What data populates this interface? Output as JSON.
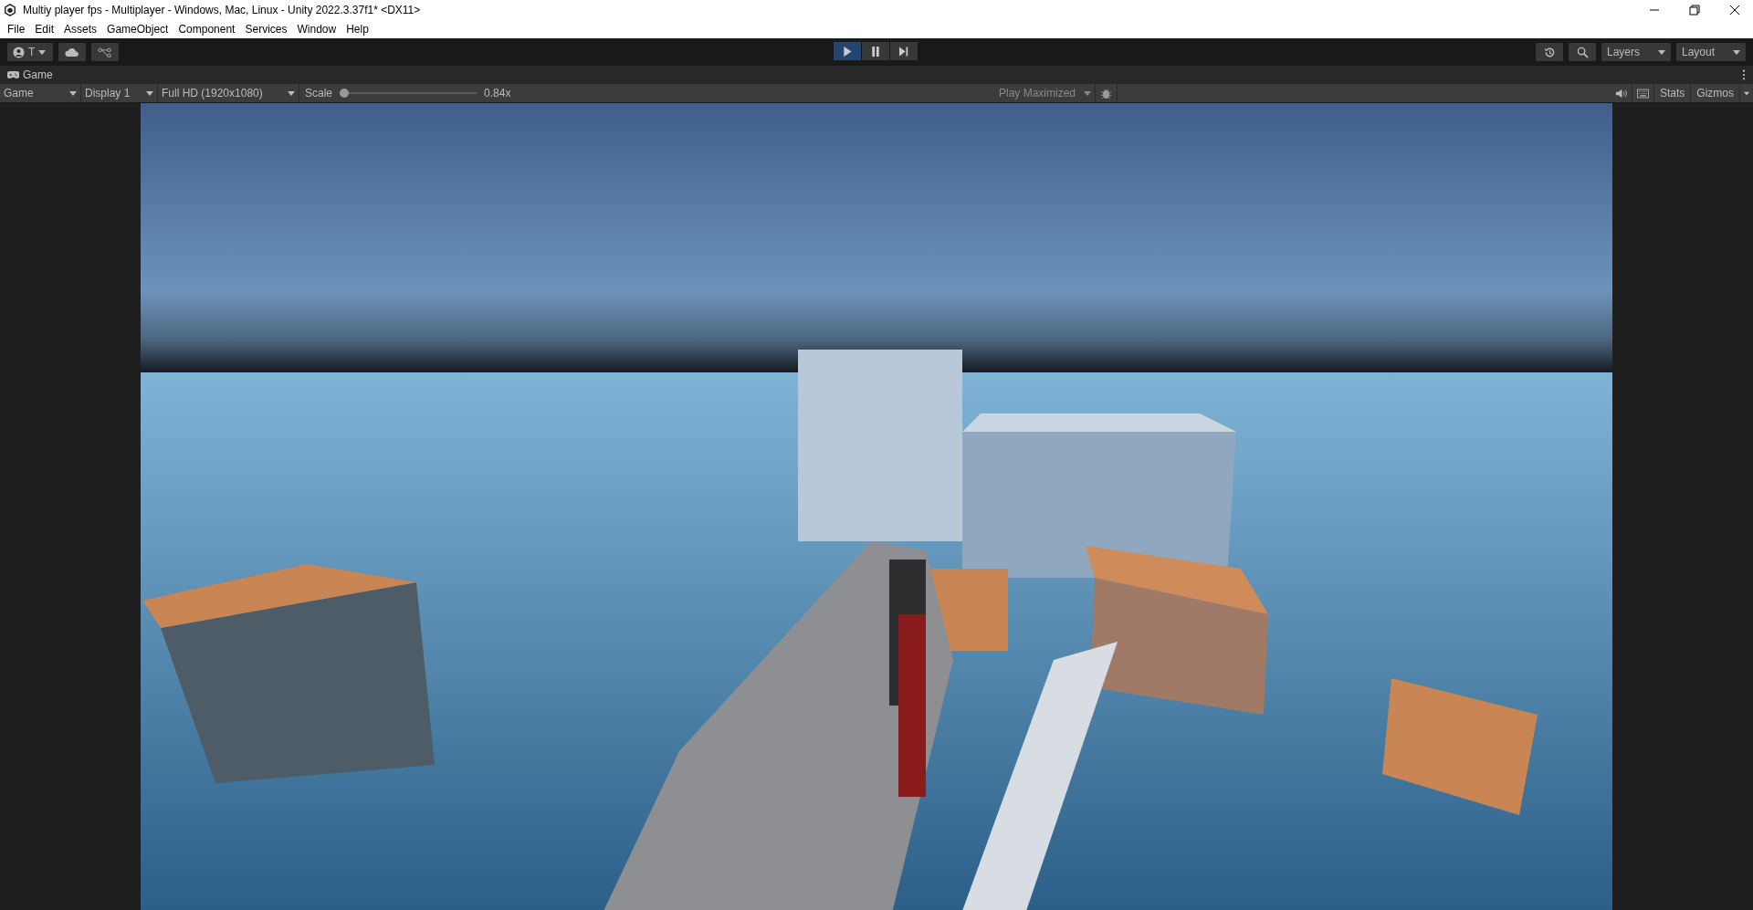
{
  "window": {
    "title": "Multiy player fps - Multiplayer - Windows, Mac, Linux - Unity 2022.3.37f1* <DX11>"
  },
  "menu": [
    "File",
    "Edit",
    "Assets",
    "GameObject",
    "Component",
    "Services",
    "Window",
    "Help"
  ],
  "toolbar": {
    "account": "T",
    "play_controls": [
      {
        "kind": "play",
        "selected": true
      },
      {
        "kind": "pause",
        "selected": false
      },
      {
        "kind": "step",
        "selected": false
      }
    ],
    "layers": "Layers",
    "layout": "Layout"
  },
  "panel": {
    "tab": "Game"
  },
  "game_toolbar": {
    "view": "Game",
    "display": "Display 1",
    "resolution": "Full HD (1920x1080)",
    "scale_label": "Scale",
    "scale": {
      "level": 0.0
    },
    "scale_reading": "0.84x",
    "play_mode": "Play Maximized",
    "stats": "Stats",
    "gizmos": "Gizmos"
  }
}
